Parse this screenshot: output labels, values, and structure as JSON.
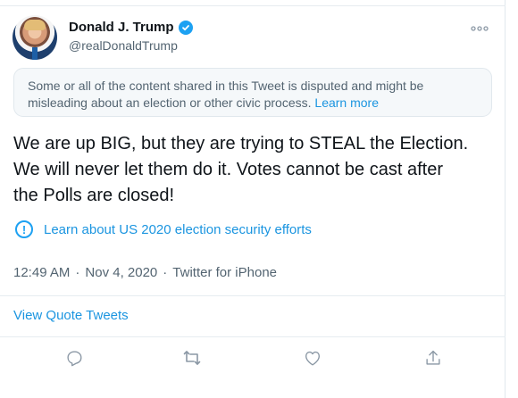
{
  "tweet": {
    "author": {
      "name": "Donald J. Trump",
      "handle": "@realDonaldTrump"
    },
    "menu_icon": "more-horizontal-icon",
    "notice": {
      "text": "Some or all of the content shared in this Tweet is disputed and might be misleading about an election or other civic process.",
      "link": "Learn more"
    },
    "text_lines": [
      "We are up BIG, but they are trying to STEAL the Election.",
      "We will never let them do it. Votes cannot be cast after",
      "the Polls are closed!"
    ],
    "election_link": "Learn about US 2020 election security efforts",
    "meta": {
      "time": "12:49 AM",
      "separator1": "·",
      "date": "Nov 4, 2020",
      "separator2": "·",
      "source": "Twitter for iPhone"
    },
    "quote_link": "View Quote Tweets",
    "actions": [
      "reply-icon",
      "retweet-icon",
      "like-icon",
      "share-icon"
    ]
  },
  "colors": {
    "accent": "#1da1f2",
    "text": "#0f1419",
    "muted": "#536471",
    "notice_bg": "#f5f8fa",
    "border": "#e1e8ed"
  }
}
